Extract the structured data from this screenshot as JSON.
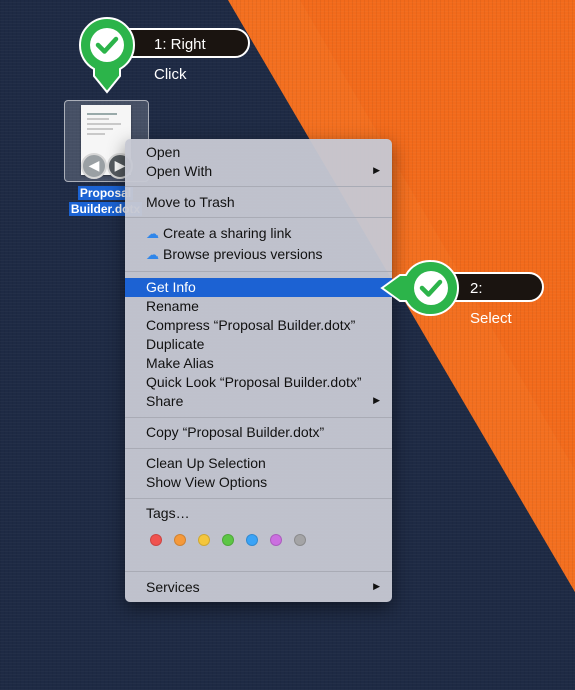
{
  "file": {
    "label_line1": "Proposal",
    "label_line2": "Builder.dotx"
  },
  "callouts": {
    "step1": "1: Right Click",
    "step2": "2: Select"
  },
  "menu": {
    "open": "Open",
    "open_with": "Open With",
    "move_to_trash": "Move to Trash",
    "create_sharing_link": "Create a sharing link",
    "browse_previous_versions": "Browse previous versions",
    "get_info": "Get Info",
    "rename": "Rename",
    "compress": "Compress “Proposal Builder.dotx”",
    "duplicate": "Duplicate",
    "make_alias": "Make Alias",
    "quick_look": "Quick Look “Proposal Builder.dotx”",
    "share": "Share",
    "copy": "Copy “Proposal Builder.dotx”",
    "clean_up_selection": "Clean Up Selection",
    "show_view_options": "Show View Options",
    "tags": "Tags…",
    "services": "Services",
    "submenu_arrow": "▶"
  },
  "tag_colors": [
    "#f0524f",
    "#f5993a",
    "#f4c63c",
    "#5cc645",
    "#3aa3f6",
    "#cb6fe0",
    "#a4a4a6"
  ],
  "colors": {
    "desktop_navy": "#1e2a44",
    "desktop_orange": "#f26a1b",
    "callout_green": "#2cb44a",
    "selection_blue": "#1c62d3"
  },
  "icons": {
    "checkmark": "checkmark-icon",
    "cloud": "cloud-icon",
    "chevron_left": "chevron-left-icon",
    "chevron_right": "chevron-right-icon"
  }
}
